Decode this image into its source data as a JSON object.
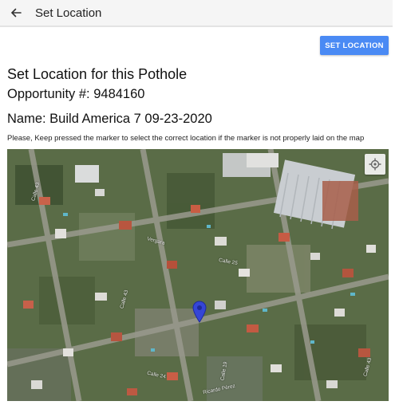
{
  "appbar": {
    "title": "Set Location",
    "back_icon": "arrow-left-icon"
  },
  "actions": {
    "set_location_label": "SET LOCATION",
    "accent_color": "#4a8af4"
  },
  "content": {
    "heading": "Set Location for this Pothole",
    "opportunity": "Opportunity #: 9484160",
    "name": "Name: Build America 7 09-23-2020",
    "instruction": "Please, Keep pressed the marker to select the correct location if the marker is not properly laid on the map"
  },
  "map": {
    "type": "satellite",
    "marker_color": "#3546d6",
    "locate_icon": "crosshair-icon",
    "street_labels": [
      "Calle 43",
      "Vergara",
      "Calle 25",
      "Calle 43",
      "Calle 24",
      "Calle 19",
      "Ricardo Pérez",
      "Calle 43"
    ]
  }
}
